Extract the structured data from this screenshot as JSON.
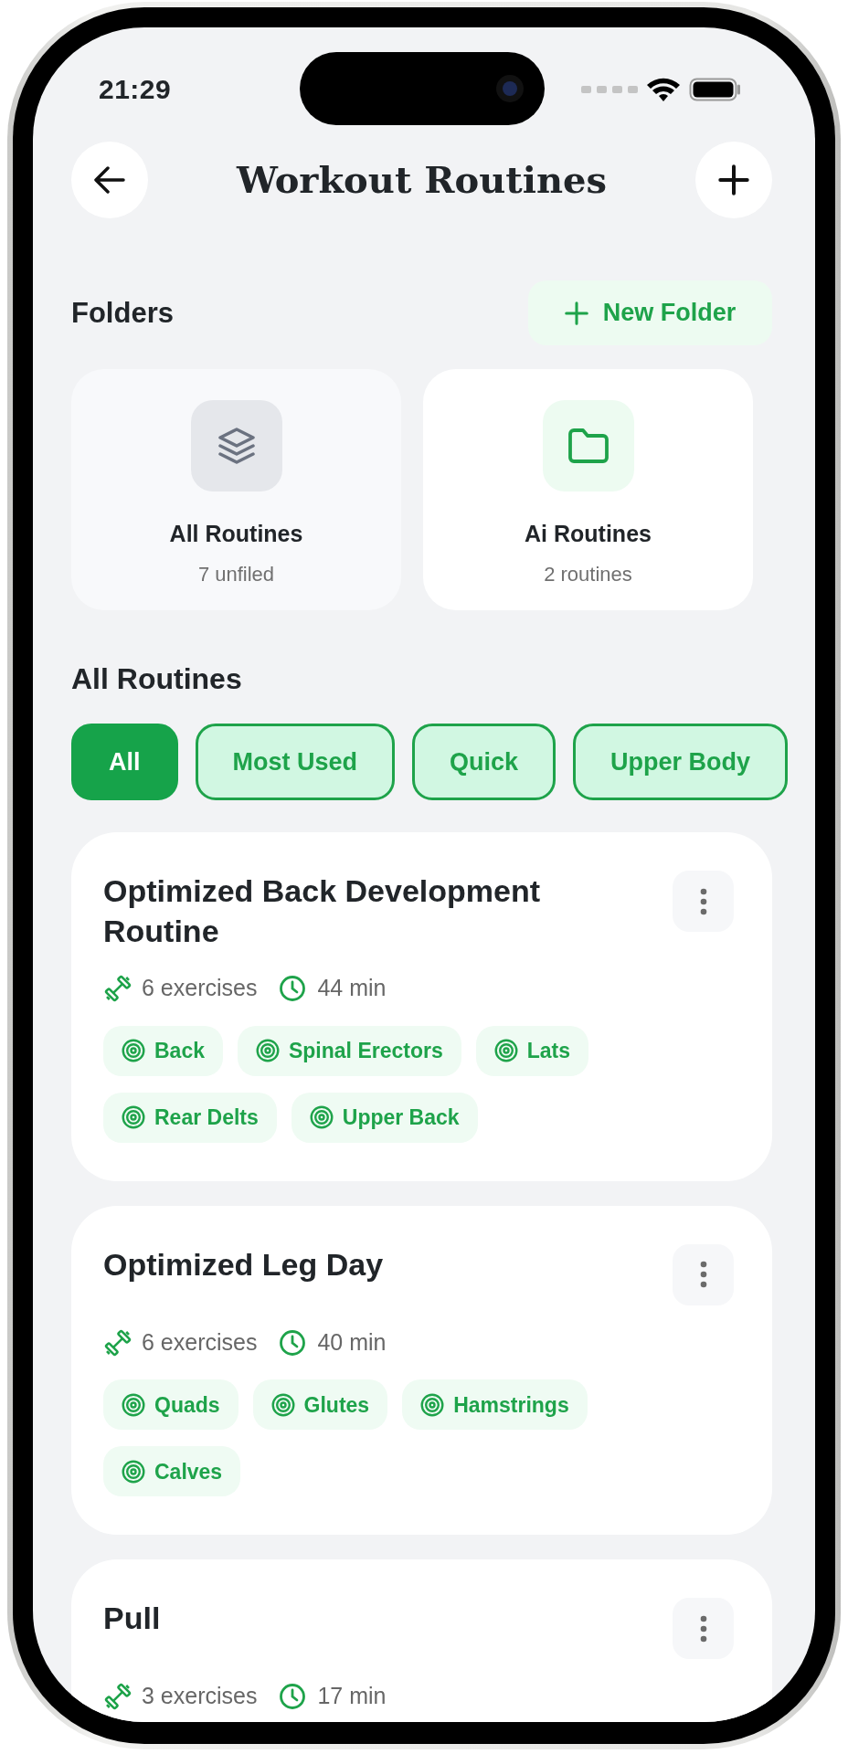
{
  "status_bar": {
    "time": "21:29"
  },
  "header": {
    "title": "Workout Routines"
  },
  "folders": {
    "heading": "Folders",
    "new_button": "New Folder",
    "items": [
      {
        "kind": "stack",
        "name": "All Routines",
        "count": "7 unfiled"
      },
      {
        "kind": "folder",
        "name": "Ai Routines",
        "count": "2 routines"
      }
    ]
  },
  "routines": {
    "heading": "All Routines",
    "filters": [
      {
        "label": "All",
        "selected": true
      },
      {
        "label": "Most Used",
        "selected": false
      },
      {
        "label": "Quick",
        "selected": false
      },
      {
        "label": "Upper Body",
        "selected": false
      }
    ],
    "items": [
      {
        "title": "Optimized Back Development Routine",
        "exercises": "6 exercises",
        "duration": "44 min",
        "muscles": [
          "Back",
          "Spinal Erectors",
          "Lats",
          "Rear Delts",
          "Upper Back"
        ]
      },
      {
        "title": "Optimized Leg Day",
        "exercises": "6 exercises",
        "duration": "40 min",
        "muscles": [
          "Quads",
          "Glutes",
          "Hamstrings",
          "Calves"
        ]
      },
      {
        "title": "Pull",
        "exercises": "3 exercises",
        "duration": "17 min"
      }
    ]
  }
}
